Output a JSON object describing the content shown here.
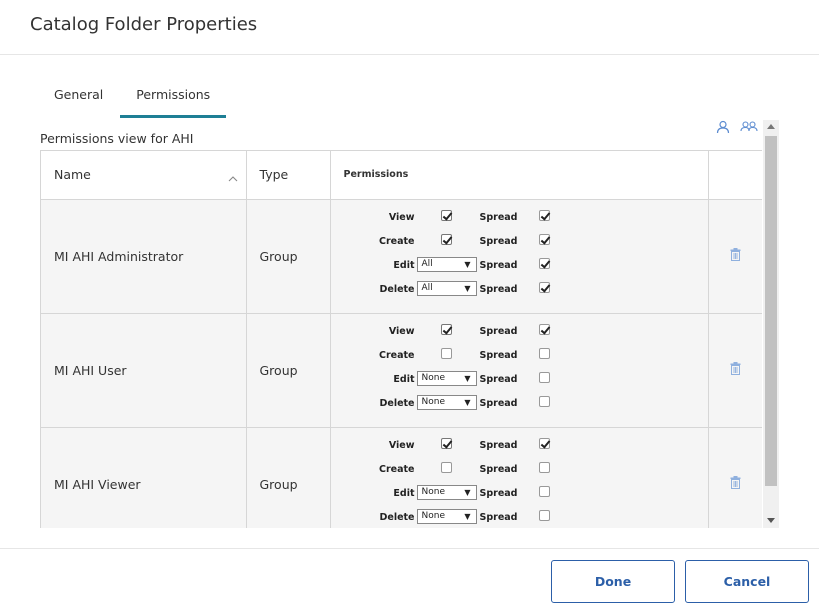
{
  "dialog": {
    "title": "Catalog Folder Properties"
  },
  "tabs": [
    {
      "label": "General",
      "active": false
    },
    {
      "label": "Permissions",
      "active": true
    }
  ],
  "permissions_view_label": "Permissions view for AHI",
  "icons": {
    "add_user": "user-icon",
    "add_group": "group-icon",
    "delete": "trash-icon",
    "sort": "chevron-up-icon"
  },
  "colors": {
    "accent": "#1e7f95",
    "button": "#2c5fa8",
    "icon": "#5b8bd0"
  },
  "table": {
    "headers": {
      "name": "Name",
      "type": "Type",
      "permissions": "Permissions"
    },
    "rows": [
      {
        "name": "MI AHI Administrator",
        "type": "Group",
        "view": {
          "label": "View",
          "checked": true,
          "spread_label": "Spread",
          "spread": true
        },
        "create": {
          "label": "Create",
          "checked": true,
          "spread_label": "Spread",
          "spread": true
        },
        "edit": {
          "label": "Edit",
          "value": "All",
          "spread_label": "Spread",
          "spread": true
        },
        "delete": {
          "label": "Delete",
          "value": "All",
          "spread_label": "Spread",
          "spread": true
        }
      },
      {
        "name": "MI AHI User",
        "type": "Group",
        "view": {
          "label": "View",
          "checked": true,
          "spread_label": "Spread",
          "spread": true
        },
        "create": {
          "label": "Create",
          "checked": false,
          "spread_label": "Spread",
          "spread": false
        },
        "edit": {
          "label": "Edit",
          "value": "None",
          "spread_label": "Spread",
          "spread": false
        },
        "delete": {
          "label": "Delete",
          "value": "None",
          "spread_label": "Spread",
          "spread": false
        }
      },
      {
        "name": "MI AHI Viewer",
        "type": "Group",
        "view": {
          "label": "View",
          "checked": true,
          "spread_label": "Spread",
          "spread": true
        },
        "create": {
          "label": "Create",
          "checked": false,
          "spread_label": "Spread",
          "spread": false
        },
        "edit": {
          "label": "Edit",
          "value": "None",
          "spread_label": "Spread",
          "spread": false
        },
        "delete": {
          "label": "Delete",
          "value": "None",
          "spread_label": "Spread",
          "spread": false
        }
      }
    ]
  },
  "buttons": {
    "done": "Done",
    "cancel": "Cancel"
  }
}
